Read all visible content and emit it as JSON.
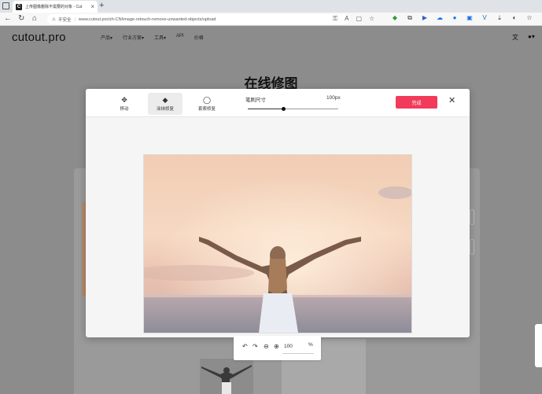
{
  "browser": {
    "tab_title": "上传图像删除不需要的对象 - Cut",
    "favicon_letter": "C",
    "new_tab": "+",
    "not_secure": "不安全",
    "url": "www.cutout.pro/zh-CN/image-retouch-remove-unwanted-objects/upload"
  },
  "site": {
    "logo": "cutout.pro",
    "nav": [
      "产品▾",
      "行业方案▾",
      "工具▾",
      "API",
      "价格"
    ],
    "page_title": "在线修图"
  },
  "editor": {
    "tools": [
      {
        "label": "移动",
        "icon": "move-icon"
      },
      {
        "label": "涂抹修复",
        "icon": "eraser-icon"
      },
      {
        "label": "套索修复",
        "icon": "lasso-icon"
      }
    ],
    "brush_label": "笔刷尺寸",
    "brush_value": "100px",
    "brush_fraction": 0.39,
    "done_label": "完成",
    "zoom_value": "100",
    "zoom_unit": "%"
  },
  "colors": {
    "accent": "#f23b5a"
  }
}
